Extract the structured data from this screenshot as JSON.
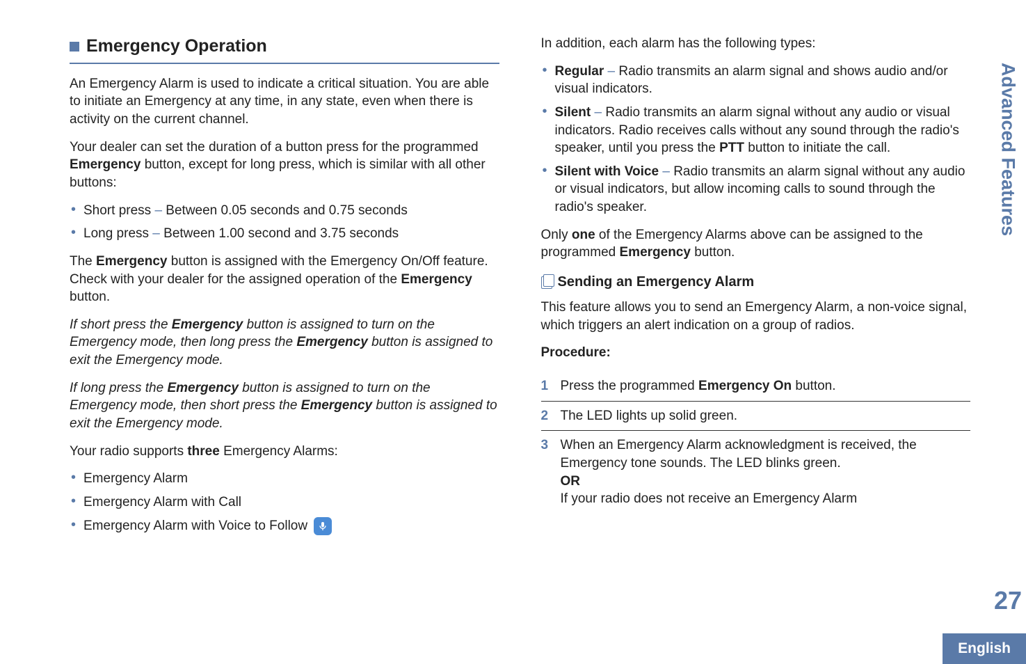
{
  "section_tab": "Advanced Features",
  "page_number": "27",
  "language_label": "English",
  "left": {
    "heading": "Emergency Operation",
    "p1": "An Emergency Alarm is used to indicate a critical situation. You are able to initiate an Emergency at any time, in any state, even when there is activity on the current channel.",
    "p2a": "Your dealer can set the duration of a button press for the programmed ",
    "p2b": "Emergency",
    "p2c": " button, except for long press, which is similar with all other buttons:",
    "press_items": [
      {
        "label": "Short press",
        "rest": " Between 0.05 seconds and 0.75 seconds"
      },
      {
        "label": "Long press",
        "rest": " Between 1.00 second and 3.75 seconds"
      }
    ],
    "p3_parts": [
      "The ",
      "Emergency",
      " button is assigned with the Emergency On/Off feature. Check with your dealer for the assigned operation of the ",
      "Emergency",
      " button."
    ],
    "p4_parts": [
      "If short press the ",
      "Emergency",
      " button is assigned to turn on the Emergency mode, then long press the ",
      "Emergency",
      " button is assigned to exit the Emergency mode."
    ],
    "p5_parts": [
      "If long press the ",
      "Emergency",
      " button is assigned to turn on the Emergency mode, then short press the ",
      "Emergency",
      " button is assigned to exit the Emergency mode."
    ],
    "p6_parts": [
      "Your radio supports ",
      "three",
      " Emergency Alarms:"
    ],
    "alarm_list": [
      "Emergency Alarm",
      "Emergency Alarm with Call",
      "Emergency Alarm with Voice to Follow"
    ]
  },
  "right": {
    "p1": "In addition, each alarm has the following types:",
    "types": [
      {
        "name": "Regular",
        "rest": " Radio transmits an alarm signal and shows audio and/or visual indicators."
      },
      {
        "name": "Silent",
        "rest_parts": [
          " Radio transmits an alarm signal without any audio or visual indicators. Radio receives calls without any sound through the radio's speaker, until you press the ",
          "PTT",
          " button to initiate the call."
        ]
      },
      {
        "name": "Silent with Voice",
        "rest": " Radio transmits an alarm signal without any audio or visual indicators, but allow incoming calls to sound through the radio's speaker."
      }
    ],
    "p2_parts": [
      "Only ",
      "one",
      " of the Emergency Alarms above can be assigned to the programmed ",
      "Emergency",
      " button."
    ],
    "subheading": "Sending an Emergency Alarm",
    "p3": "This feature allows you to send an Emergency Alarm, a non-voice signal, which triggers an alert indication on a group of radios.",
    "procedure_label": "Procedure:",
    "steps": [
      {
        "num": "1",
        "pre": "Press the programmed ",
        "bold": "Emergency On",
        "post": " button.",
        "underline": true
      },
      {
        "num": "2",
        "text": "The LED lights up solid green.",
        "underline": true
      },
      {
        "num": "3",
        "lines": [
          "When an Emergency Alarm acknowledgment is received, the Emergency tone sounds. The LED blinks green.",
          "OR",
          "If your radio does not receive an Emergency Alarm"
        ]
      }
    ]
  }
}
